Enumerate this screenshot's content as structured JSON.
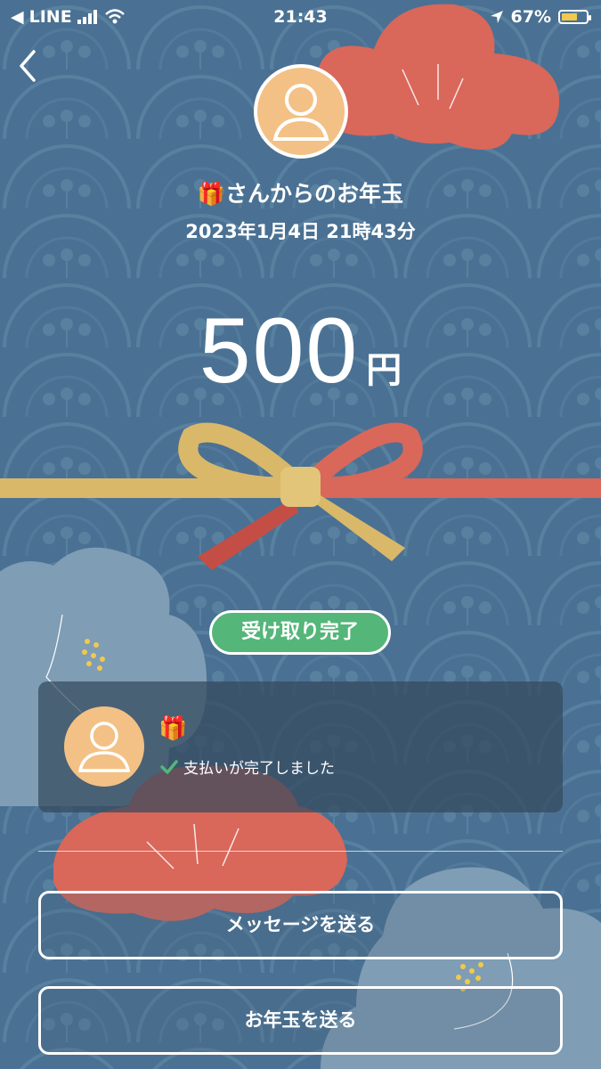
{
  "status_bar": {
    "carrier": "LINE",
    "time": "21:43",
    "battery_percent": "67%",
    "battery_level": 0.67
  },
  "gift": {
    "gift_emoji": "🎁",
    "title": "🎁さんからのお年玉",
    "date": "2023年1月4日 21時43分",
    "amount": "500",
    "currency": "円"
  },
  "status_badge": "受け取り完了",
  "card": {
    "gift_emoji": "🎁",
    "message": "支払いが完了しました"
  },
  "buttons": {
    "send_message": "メッセージを送る",
    "send_otoshidama": "お年玉を送る"
  },
  "colors": {
    "background": "#4a7193",
    "accent_red": "#d9675a",
    "badge_green": "#55b67a",
    "avatar": "#f3c185",
    "ribbon_gold": "#d9b86a"
  }
}
